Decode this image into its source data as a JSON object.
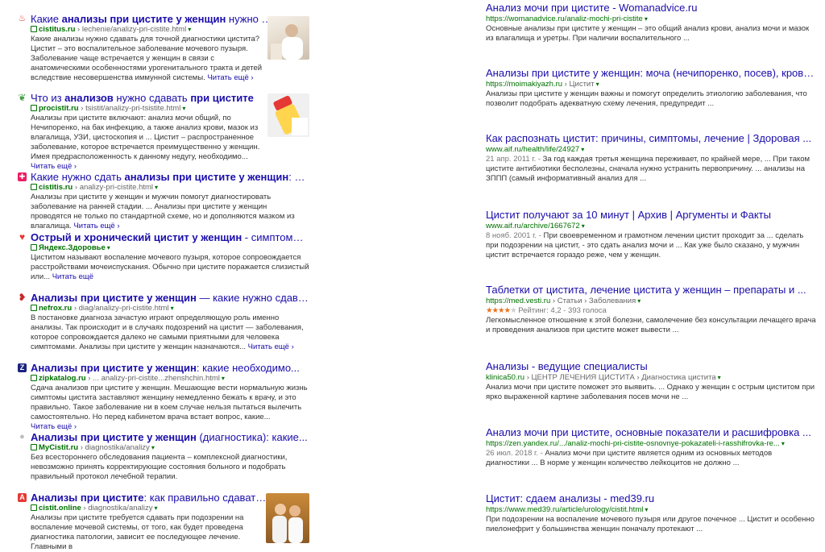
{
  "left_results": [
    {
      "title_plain_a": "Какие ",
      "title_bold_a": "анализы",
      "title_plain_b": " при цистите у женщин",
      "title_bold_b": "",
      "title_plain_c": " нужно сдавать",
      "domain": "cistitus.ru",
      "path": " › lechenie/analizy-pri-cistite.html",
      "snippet": "Какие анализы нужно сдавать для точной диагностики цистита? Цистит – это воспалительное заболевание мочевого пузыря. Заболевание чаще встречается у женщин в связи с анатомическими особенностями урогенитального тракта и детей вследствие несовершенства иммунной системы.",
      "more": "Читать ещё ›",
      "favicon": {
        "icon": "flame-icon",
        "color": "#e53935",
        "glyph": "♨"
      }
    },
    {
      "title_plain_a": "Что из ",
      "title_bold_a": "анализов",
      "title_plain_b": " нужно сдавать ",
      "title_bold_b": "при цистите",
      "title_plain_c": "",
      "domain": "procistit.ru",
      "path": " › tsistit/analizy-pri-tsistite.html",
      "snippet": "Анализы при цистите включают: анализ мочи общий, по Нечипоренко, на бак инфекцию, а также анализ крови, мазок из влагалища, УЗИ, цистоскопия и ... Цистит – распространенное заболевание, которое встречается преимущественно у женщин. Имея предрасположенность к данному недугу, необходимо...",
      "more": "Читать ещё ›",
      "favicon": {
        "icon": "leaf-icon",
        "color": "#43a047",
        "glyph": "❦"
      }
    },
    {
      "title_plain_a": "Какие нужно сдать ",
      "title_bold_a": "анализы при цистите у женщин",
      "title_plain_b": ": как...",
      "title_bold_b": "",
      "title_plain_c": "",
      "domain": "cistitis.ru",
      "path": " › analizy-pri-cistite.html",
      "snippet": "Анализы при цистите у женщин и мужчин помогут диагностировать заболевание на ранней стадии. ... Анализы при цистите у женщин проводятся не только по стандартной схеме, но и дополняются мазком из влагалища.",
      "more": "Читать ещё ›",
      "favicon": {
        "icon": "cross-icon",
        "color": "#e91e63",
        "glyph": "✚"
      }
    },
    {
      "title_plain_a": "",
      "title_bold_a": "Острый и хронический цистит у женщин",
      "title_plain_b": " - симптомы, лече...",
      "title_bold_b": "",
      "title_plain_c": "",
      "domain": "Яндекс.Здоровье",
      "path": "",
      "snippet": "Циститом называют воспаление мочевого пузыря, которое сопровождается расстройствами мочеиспускания. Обычно при цистите поражается слизистый или...",
      "more": "Читать ещё",
      "favicon": {
        "icon": "heart-icon",
        "color": "#e53935",
        "glyph": "♥"
      }
    },
    {
      "title_plain_a": "",
      "title_bold_a": "Анализы при цистите у женщин",
      "title_plain_b": " — какие нужно сдавать",
      "title_bold_b": "",
      "title_plain_c": "",
      "domain": "nefrox.ru",
      "path": " › diag/analizy-pri-cistite.html",
      "snippet": "В постановке диагноза зачастую играют определяющую роль именно анализы. Так происходит и в случаях подозрений на цистит — заболевания, которое сопровождается далеко не самыми приятными для человека симптомами. Анализы при цистите у женщин назначаются...",
      "more": "Читать ещё ›",
      "favicon": {
        "icon": "kidney-icon",
        "color": "#c62828",
        "glyph": "❥"
      }
    },
    {
      "title_plain_a": "",
      "title_bold_a": "Анализы при цистите у женщин",
      "title_plain_b": ": какие необходимо...",
      "title_bold_b": "",
      "title_plain_c": "",
      "domain": "zipkatalog.ru",
      "path": " › ... analizy-pri-cistite...zhenshchin.html",
      "snippet": "Сдача анализов при цистите у женщин. Мешающие вести нормальную жизнь симптомы цистита заставляют женщину немедленно бежать к врачу, и это правильно. Такое заболевание ни в коем случае нельзя пытаться вылечить самостоятельно. Но перед кабинетом врача встает вопрос, какие...",
      "more": "Читать ещё ›",
      "favicon": {
        "icon": "zip-icon",
        "color": "#1a237e",
        "glyph": "Z"
      }
    },
    {
      "title_plain_a": "",
      "title_bold_a": "Анализы при цистите у женщин",
      "title_plain_b": " (диагностика): какие...",
      "title_bold_b": "",
      "title_plain_c": "",
      "domain": "MyCistit.ru",
      "path": " › diagnostika/analizy",
      "snippet": "Без всестороннего обследования пациента – комплексной диагностики, невозможно принять корректирующие состояния больного и подобрать правильный протокол лечебной терапии.",
      "more": "",
      "favicon": {
        "icon": "circle-icon",
        "color": "#bdbdbd",
        "glyph": "●"
      }
    },
    {
      "title_plain_a": "",
      "title_bold_a": "Анализы при цистите",
      "title_plain_b": ": как правильно сдавать...",
      "title_bold_b": "",
      "title_plain_c": "",
      "domain": "cistit.online",
      "path": " › diagnostika/analizy",
      "snippet": "Анализы при цистите требуется сдавать при подозрении на воспаление мочевой системы, от того, как будет проведена диагностика патологии, зависит ее последующее лечение. Главными в",
      "more": "",
      "favicon": {
        "icon": "warning-icon",
        "color": "#e53935",
        "glyph": "A"
      }
    }
  ],
  "right_results": [
    {
      "title": "Анализ мочи при цистите - Womanadvice.ru",
      "url_a": "https://womanadvice.ru/analiz-mochi-pri-cistite",
      "url_b": "",
      "snippet": "Основные анализы при цистите у женщин – это общий анализ крови, анализ мочи и мазок из влагалища и уретры. При наличии воспалительного ..."
    },
    {
      "title": "Анализы при цистите у женщин: моча (нечипоренко, посев), кровь ...",
      "url_a": "https://moimakiyazh.ru",
      "url_b": " › Цистит",
      "snippet": "Анализы при цистите у женщин важны и помогут определить этиологию заболевания, что позволит подобрать адекватную схему лечения, предупредит ..."
    },
    {
      "title": "Как распознать цистит: причины, симптомы, лечение | Здоровая ...",
      "url_a": "www.aif.ru/health/life/24927",
      "url_b": "",
      "date": "21 апр. 2011 г. - ",
      "snippet": "За год каждая третья женщина переживает, по крайней мере, ... При таком цистите антибиотики бесполезны, сначала нужно устранить первопричину. ... анализы на ЗППП (самый информативный анализ для ..."
    },
    {
      "title": "Цистит получают за 10 минут | Архив | Аргументы и Факты",
      "url_a": "www.aif.ru/archive/1667672",
      "url_b": "",
      "date": "8 нояб. 2001 г. - ",
      "snippet": "При своевременном и грамотном лечении цистит проходит за ... сделать при подозрении на цистит, - это сдать анализ мочи и ... Как уже было сказано, у мужчин цистит встречается гораздо реже, чем у женщин."
    },
    {
      "title": "Таблетки от цистита, лечение цистита у женщин – препараты и ...",
      "url_a": "https://med.vesti.ru",
      "url_b": " › Статьи › Заболевания",
      "rating_stars": "★★★★",
      "rating_empty": "★",
      "rating_text": "Рейтинг: 4,2 - 393 голоса",
      "snippet": "Легкомысленное отношение к этой болезни, самолечение без консультации лечащего врача и проведения анализов при цистите может вывести ..."
    },
    {
      "title": "Анализы - ведущие специалисты",
      "url_a": "klinica50.ru",
      "url_b": " › ЦЕНТР ЛЕЧЕНИЯ ЦИСТИТА › Диагностика цистита",
      "snippet": "Анализ мочи при цистите поможет это выявить. ... Однако у женщин с острым циститом при ярко выраженной картине заболевания посев мочи не ..."
    },
    {
      "title": "Анализ мочи при цистите, основные показатели и расшифровка ...",
      "url_a": "https://zen.yandex.ru/.../analiz-mochi-pri-cistite-osnovnye-pokazateli-i-rasshifrovka-re...",
      "url_b": "",
      "date": "26 июл. 2018 г. - ",
      "snippet": "Анализ мочи при цистите является одним из основных методов диагностики ... В норме у женщин количество лейкоцитов не должно ..."
    },
    {
      "title": "Цистит: сдаем анализы - med39.ru",
      "url_a": "https://www.med39.ru/article/urology/cistit.html",
      "url_b": "",
      "snippet": "При подозрении на воспаление мочевого пузыря или другое почечное ... Цистит и особенно пиелонефрит у большинства женщин поначалу протекают ..."
    }
  ]
}
